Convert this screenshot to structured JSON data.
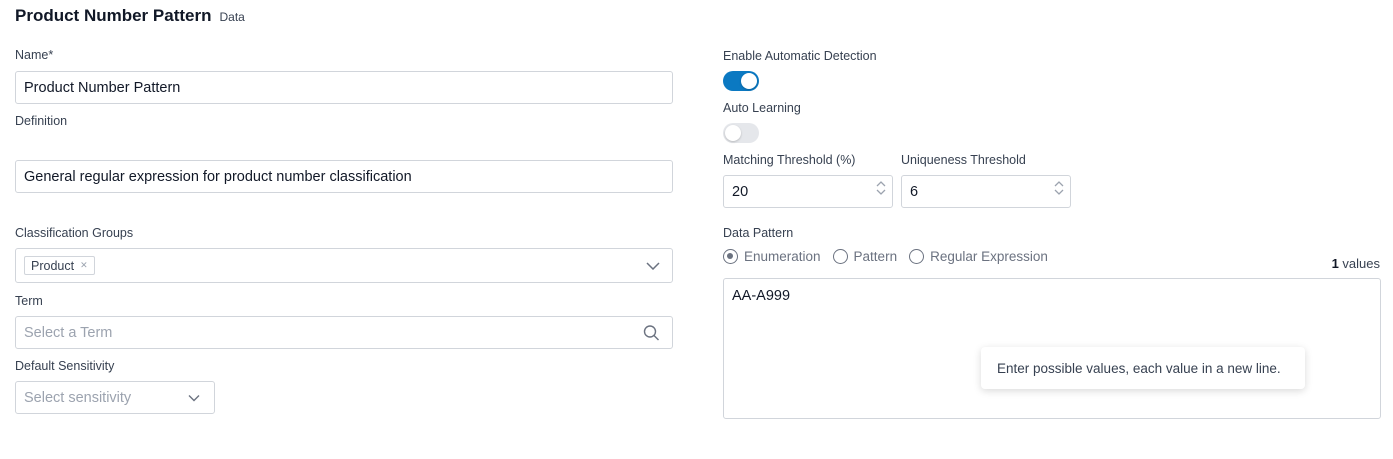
{
  "header": {
    "title": "Product Number Pattern",
    "subtitle": "Data"
  },
  "name": {
    "label": "Name*",
    "value": "Product Number Pattern"
  },
  "definition": {
    "label": "Definition",
    "value": "General regular expression for product number classification"
  },
  "classification_groups": {
    "label": "Classification Groups",
    "chips": [
      "Product"
    ]
  },
  "term": {
    "label": "Term",
    "placeholder": "Select a Term"
  },
  "sensitivity": {
    "label": "Default Sensitivity",
    "placeholder": "Select sensitivity"
  },
  "auto_detection": {
    "label": "Enable Automatic Detection",
    "enabled": true
  },
  "auto_learning": {
    "label": "Auto Learning",
    "enabled": false
  },
  "matching_threshold": {
    "label": "Matching Threshold (%)",
    "value": "20"
  },
  "uniqueness_threshold": {
    "label": "Uniqueness Threshold",
    "value": "6"
  },
  "data_pattern": {
    "label": "Data Pattern",
    "options": [
      "Enumeration",
      "Pattern",
      "Regular Expression"
    ],
    "selected": "Enumeration",
    "values_count": "1",
    "values_suffix": " values",
    "content": "AA-A999",
    "tooltip": "Enter possible values, each value in a new line."
  },
  "colors": {
    "accent": "#0b79c2",
    "border": "#d1d5db",
    "placeholder": "#9ca3af"
  }
}
